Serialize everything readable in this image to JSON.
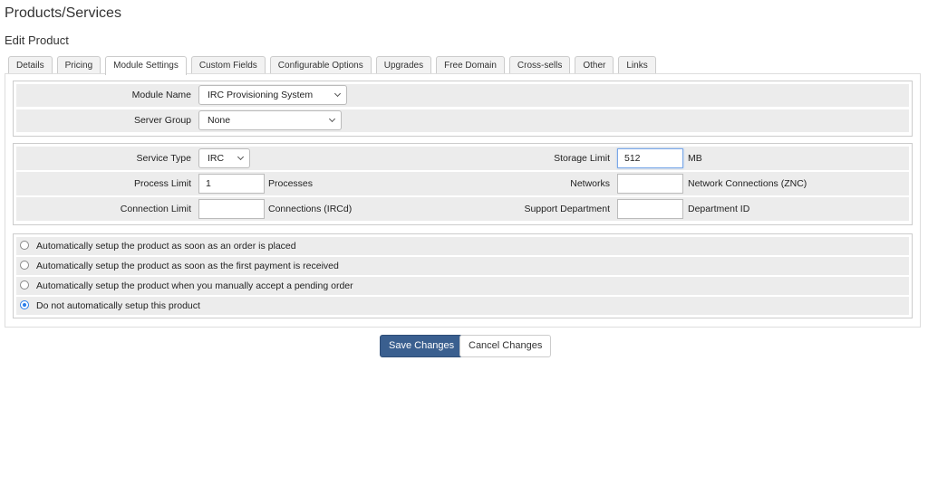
{
  "header": {
    "title": "Products/Services",
    "subtitle": "Edit Product"
  },
  "tabs": [
    {
      "label": "Details"
    },
    {
      "label": "Pricing"
    },
    {
      "label": "Module Settings",
      "active": true
    },
    {
      "label": "Custom Fields"
    },
    {
      "label": "Configurable Options"
    },
    {
      "label": "Upgrades"
    },
    {
      "label": "Free Domain"
    },
    {
      "label": "Cross-sells"
    },
    {
      "label": "Other"
    },
    {
      "label": "Links"
    }
  ],
  "module": {
    "module_name_label": "Module Name",
    "module_name_value": "IRC Provisioning System",
    "server_group_label": "Server Group",
    "server_group_value": "None"
  },
  "settings": {
    "service_type_label": "Service Type",
    "service_type_value": "IRC",
    "process_limit_label": "Process Limit",
    "process_limit_value": "1",
    "process_limit_suffix": "Processes",
    "connection_limit_label": "Connection Limit",
    "connection_limit_value": "",
    "connection_limit_suffix": "Connections (IRCd)",
    "storage_limit_label": "Storage Limit",
    "storage_limit_value": "512",
    "storage_limit_suffix": "MB",
    "networks_label": "Networks",
    "networks_value": "",
    "networks_suffix": "Network Connections (ZNC)",
    "support_department_label": "Support Department",
    "support_department_value": "",
    "support_department_suffix": "Department ID"
  },
  "autosetup": {
    "options": [
      {
        "label": "Automatically setup the product as soon as an order is placed",
        "checked": false
      },
      {
        "label": "Automatically setup the product as soon as the first payment is received",
        "checked": false
      },
      {
        "label": "Automatically setup the product when you manually accept a pending order",
        "checked": false
      },
      {
        "label": "Do not automatically setup this product",
        "checked": true
      }
    ]
  },
  "actions": {
    "save_label": "Save Changes",
    "cancel_label": "Cancel Changes"
  },
  "colors": {
    "primary_button": "#3a5f8f",
    "radio_checked": "#2b7de9",
    "row_bg": "#ececec"
  }
}
